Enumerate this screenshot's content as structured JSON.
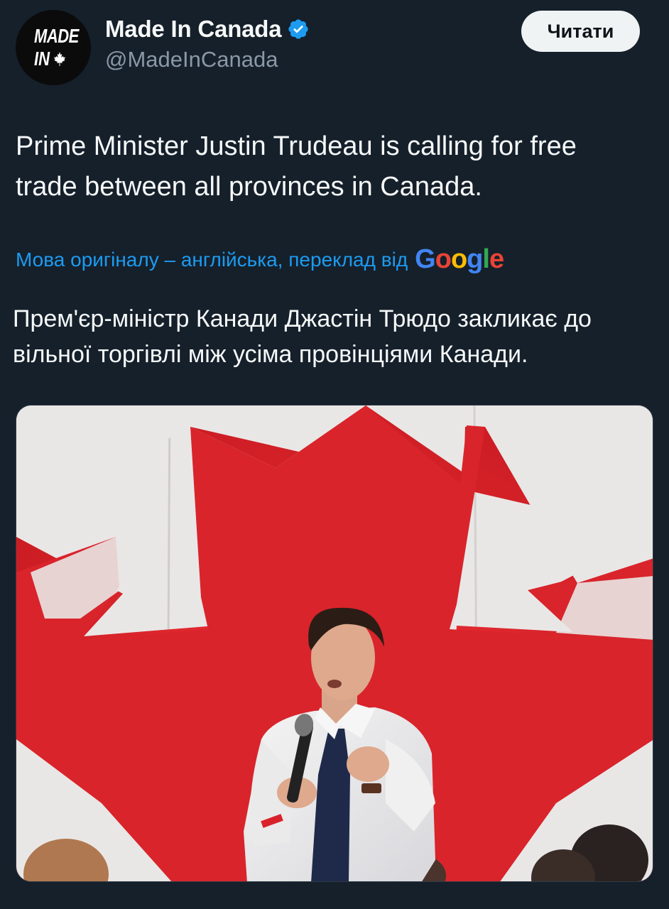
{
  "author": {
    "avatar_text_line1": "MADE",
    "avatar_text_line2": "IN",
    "display_name": "Made In Canada",
    "handle": "@MadeInCanada",
    "verified": true
  },
  "follow_button_label": "Читати",
  "tweet_text": "Prime Minister Justin Trudeau is calling for free trade between all provinces in Canada.",
  "translation": {
    "notice": "Мова оригіналу – англійська, переклад від",
    "provider": "Google",
    "text": "Прем'єр-міністр Канади Джастін Трюдо закликає до вільної торгівлі між усіма провінціями Канади."
  },
  "colors": {
    "background": "#15202b",
    "link": "#1d9bf0",
    "verified": "#1d9bf0",
    "flag_red": "#d8222a"
  },
  "icons": [
    "maple-leaf-icon",
    "verified-badge-icon"
  ],
  "media": {
    "type": "photo",
    "subject": "man in white shirt holding microphone in front of Canadian flag"
  }
}
